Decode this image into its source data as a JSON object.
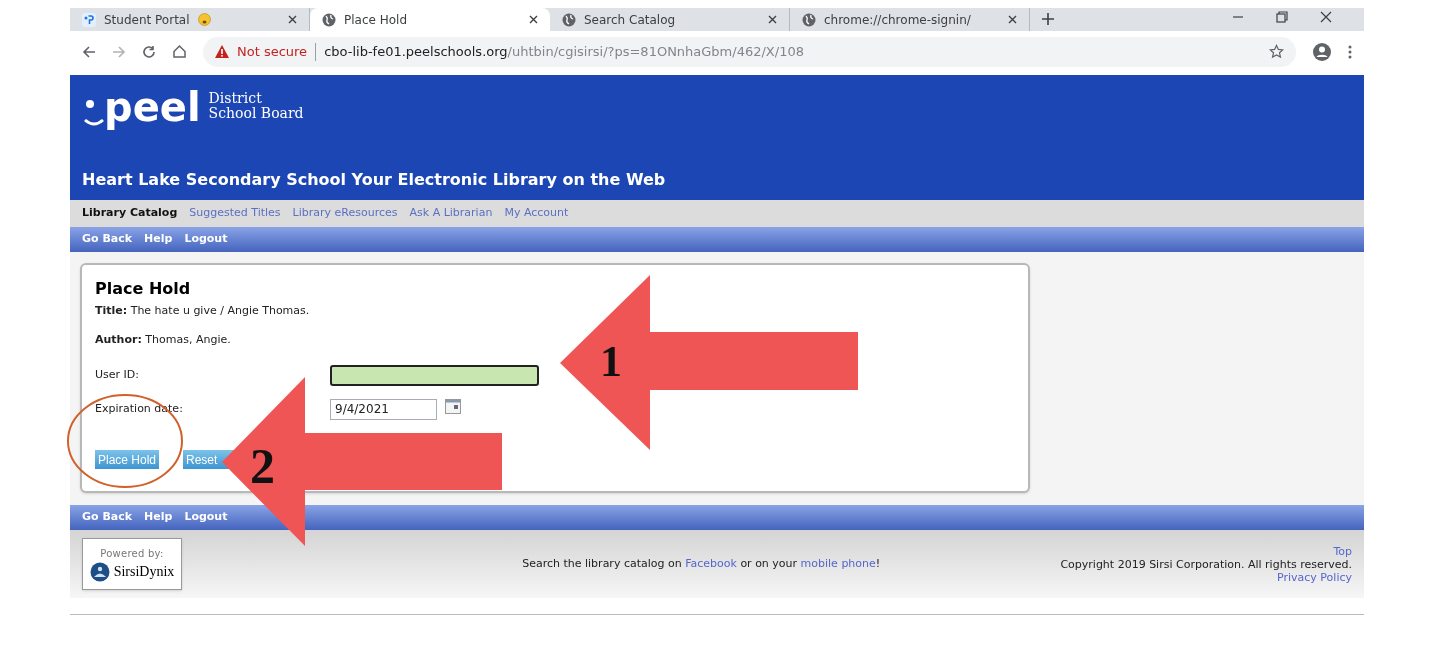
{
  "browser": {
    "tabs": [
      {
        "title": "Student Portal",
        "kind": "portal",
        "selected": false
      },
      {
        "title": "Place Hold",
        "kind": "globe",
        "selected": true
      },
      {
        "title": "Search Catalog",
        "kind": "globe",
        "selected": false
      },
      {
        "title": "chrome://chrome-signin/",
        "kind": "globe",
        "selected": false
      }
    ],
    "address": {
      "security": "Not secure",
      "host": "cbo-lib-fe01.peelschools.org",
      "path": "/uhtbin/cgisirsi/?ps=81ONnhaGbm/462/X/108"
    }
  },
  "header": {
    "logo_word": "peel",
    "logo_sub": [
      "District",
      "School Board"
    ],
    "title": "Heart Lake Secondary School Your Electronic Library on the Web"
  },
  "nav": [
    {
      "label": "Library Catalog",
      "selected": true
    },
    {
      "label": "Suggested Titles",
      "selected": false
    },
    {
      "label": "Library eResources",
      "selected": false
    },
    {
      "label": "Ask A Librarian",
      "selected": false
    },
    {
      "label": "My Account",
      "selected": false
    }
  ],
  "toolbar_top": [
    "Go Back",
    "Help",
    "Logout"
  ],
  "form": {
    "heading": "Place Hold",
    "details": [
      {
        "label": "Title:",
        "value": "The hate u give / Angie Thomas."
      },
      {
        "label": "Author:",
        "value": "Thomas, Angie."
      }
    ],
    "fields": [
      {
        "label": "User ID:",
        "kind": "text",
        "focused": true
      },
      {
        "label": "Expiration date:",
        "kind": "date",
        "value": "9/4/2021",
        "focused": false
      }
    ],
    "buttons": [
      "Place Hold",
      "Reset"
    ]
  },
  "toolbar_bottom": [
    "Go Back",
    "Help",
    "Logout"
  ],
  "footer": {
    "powered": "Powered by:",
    "brand": "SirsiDynix",
    "line": [
      {
        "text": "Search the library catalog on ",
        "kind": "text"
      },
      {
        "text": "Facebook",
        "kind": "link"
      },
      {
        "text": " or on your ",
        "kind": "text"
      },
      {
        "text": "mobile phone",
        "kind": "link"
      },
      {
        "text": "!",
        "kind": "text"
      }
    ],
    "top": "Top",
    "copyright": "Copyright 2019 Sirsi Corporation. All rights reserved.",
    "privacy": "Privacy Policy"
  },
  "annotations": [
    {
      "kind": "arrow",
      "label": "1"
    },
    {
      "kind": "arrow",
      "label": "2"
    },
    {
      "kind": "circle"
    }
  ]
}
